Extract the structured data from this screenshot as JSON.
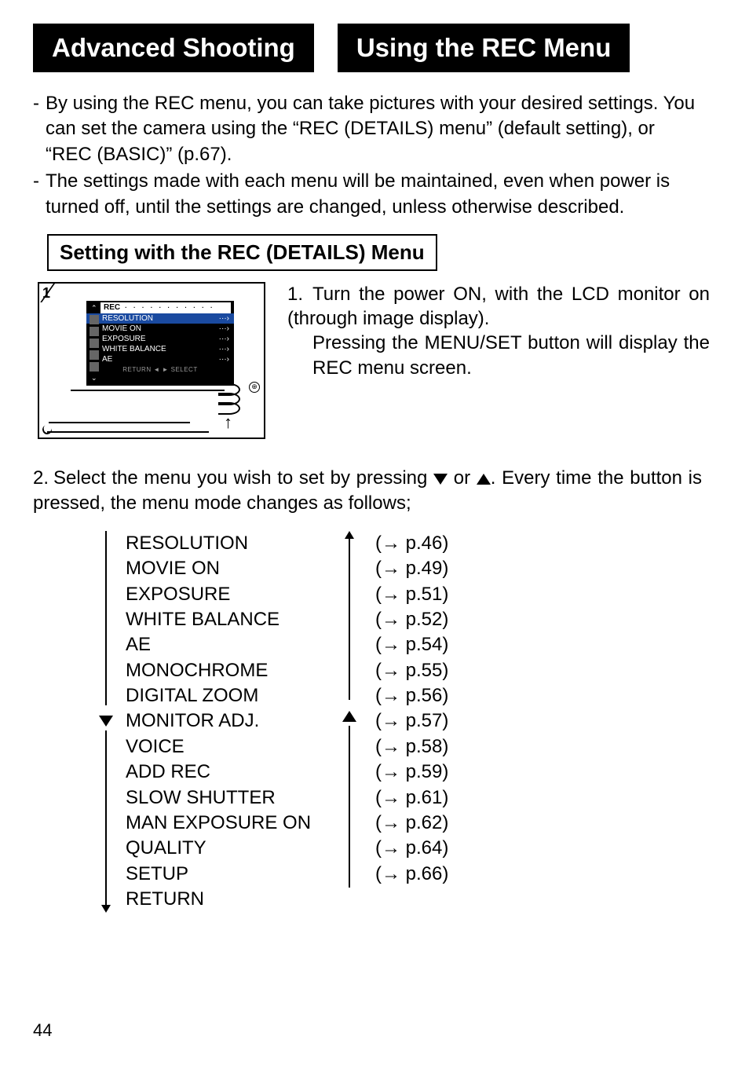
{
  "header": {
    "left": "Advanced Shooting",
    "right": "Using the REC Menu"
  },
  "intro": {
    "bullet1": "By using the REC menu, you can take pictures with your desired settings. You can set the camera using the “REC (DETAILS) menu” (default setting), or “REC (BASIC)” (p.67).",
    "bullet2": "The settings made with each menu will be maintained, even when power is turned off, until the settings are changed, unless otherwise described."
  },
  "section_title": "Setting with the REC (DETAILS) Menu",
  "figure": {
    "number": "1",
    "lcd": {
      "title": "REC",
      "items": [
        "RESOLUTION",
        "MOVIE ON",
        "EXPOSURE",
        "WHITE BALANCE",
        "AE"
      ],
      "footer": "RETURN ◄   ► SELECT"
    }
  },
  "step1": {
    "num": "1.",
    "line1": "Turn the power ON, with the LCD monitor on (through image display).",
    "line2": "Pressing the MENU/SET button will display the REC menu screen."
  },
  "step2": {
    "num": "2.",
    "text_a": "Select the menu you wish to set by pressing ",
    "text_b": " or ",
    "text_c": ". Every time the button is pressed, the menu mode changes as follows;"
  },
  "menu_items": [
    {
      "name": "RESOLUTION",
      "ref": "(→ p.46)"
    },
    {
      "name": "MOVIE ON",
      "ref": "(→ p.49)"
    },
    {
      "name": "EXPOSURE",
      "ref": "(→ p.51)"
    },
    {
      "name": "WHITE BALANCE",
      "ref": "(→ p.52)"
    },
    {
      "name": "AE",
      "ref": "(→ p.54)"
    },
    {
      "name": "MONOCHROME",
      "ref": "(→ p.55)"
    },
    {
      "name": "DIGITAL ZOOM",
      "ref": "(→ p.56)"
    },
    {
      "name": "MONITOR  ADJ.",
      "ref": "(→ p.57)"
    },
    {
      "name": "VOICE",
      "ref": "(→ p.58)"
    },
    {
      "name": "ADD REC",
      "ref": "(→ p.59)"
    },
    {
      "name": "SLOW SHUTTER",
      "ref": "(→ p.61)"
    },
    {
      "name": "MAN EXPOSURE ON",
      "ref": "(→ p.62)"
    },
    {
      "name": "QUALITY",
      "ref": "(→ p.64)"
    },
    {
      "name": "SETUP",
      "ref": "(→ p.66)"
    },
    {
      "name": "RETURN",
      "ref": ""
    }
  ],
  "page_number": "44"
}
